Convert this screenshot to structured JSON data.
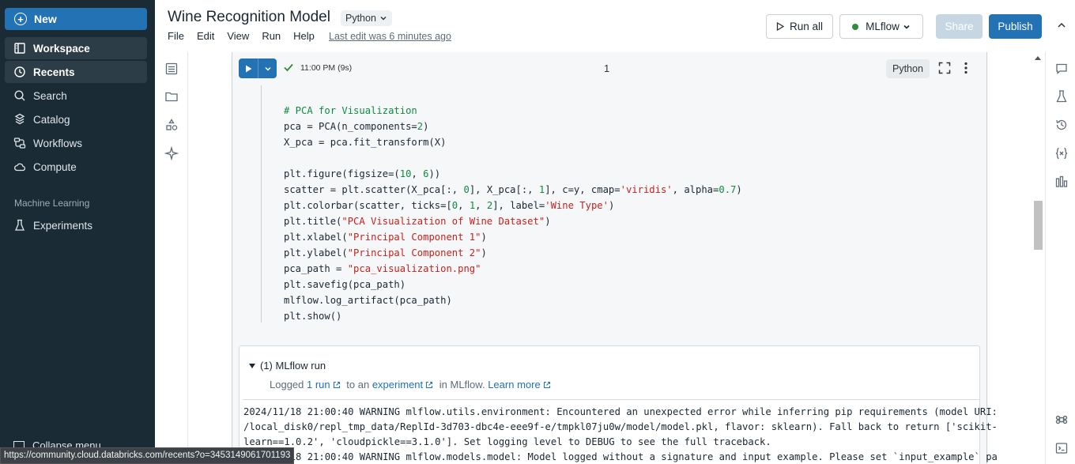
{
  "sidebar": {
    "new_label": "New",
    "items": [
      {
        "label": "Workspace",
        "icon": "workspace-icon"
      },
      {
        "label": "Recents",
        "icon": "clock-icon"
      },
      {
        "label": "Search",
        "icon": "search-icon"
      },
      {
        "label": "Catalog",
        "icon": "catalog-icon"
      },
      {
        "label": "Workflows",
        "icon": "workflows-icon"
      },
      {
        "label": "Compute",
        "icon": "cloud-icon"
      }
    ],
    "section_label": "Machine Learning",
    "ml_items": [
      {
        "label": "Experiments",
        "icon": "flask-icon"
      }
    ],
    "collapse_label": "Collapse menu"
  },
  "status_url": "https://community.cloud.databricks.com/recents?o=3453149061701193",
  "header": {
    "title": "Wine Recognition Model",
    "language": "Python",
    "menu": [
      "File",
      "Edit",
      "View",
      "Run",
      "Help"
    ],
    "last_edit": "Last edit was 6 minutes ago",
    "run_all": "Run all",
    "compute": "MLflow",
    "compute_status_color": "#2e8b3d",
    "share": "Share",
    "publish": "Publish"
  },
  "cell": {
    "time": "11:00 PM (9s)",
    "count": "1",
    "language": "Python",
    "code": [
      "# PCA for Visualization",
      "pca = PCA(n_components=2)",
      "X_pca = pca.fit_transform(X)",
      "",
      "plt.figure(figsize=(10, 6))",
      "scatter = plt.scatter(X_pca[:, 0], X_pca[:, 1], c=y, cmap='viridis', alpha=0.7)",
      "plt.colorbar(scatter, ticks=[0, 1, 2], label='Wine Type')",
      "plt.title(\"PCA Visualization of Wine Dataset\")",
      "plt.xlabel(\"Principal Component 1\")",
      "plt.ylabel(\"Principal Component 2\")",
      "pca_path = \"pca_visualization.png\"",
      "plt.savefig(pca_path)",
      "mlflow.log_artifact(pca_path)",
      "plt.show()"
    ]
  },
  "results": {
    "run_header": "(1) MLflow run",
    "logged": "Logged",
    "run_link": "1 run",
    "to_an": "to an",
    "experiment_link": "experiment",
    "in_mlflow": "in MLflow.",
    "learn_more": "Learn more",
    "log_lines": [
      "2024/11/18 21:00:40 WARNING mlflow.utils.environment: Encountered an unexpected error while inferring pip requirements (model URI:",
      "/local_disk0/repl_tmp_data/ReplId-3d703-dbc4e-eee9f-e/tmpkl07ju0w/model/model.pkl, flavor: sklearn). Fall back to return ['scikit-",
      "learn==1.0.2', 'cloudpickle==3.1.0']. Set logging level to DEBUG to see the full traceback.",
      "2024/11/18 21:00:40 WARNING mlflow.models.model: Model logged without a signature and input example. Please set `input_example` pa"
    ]
  }
}
